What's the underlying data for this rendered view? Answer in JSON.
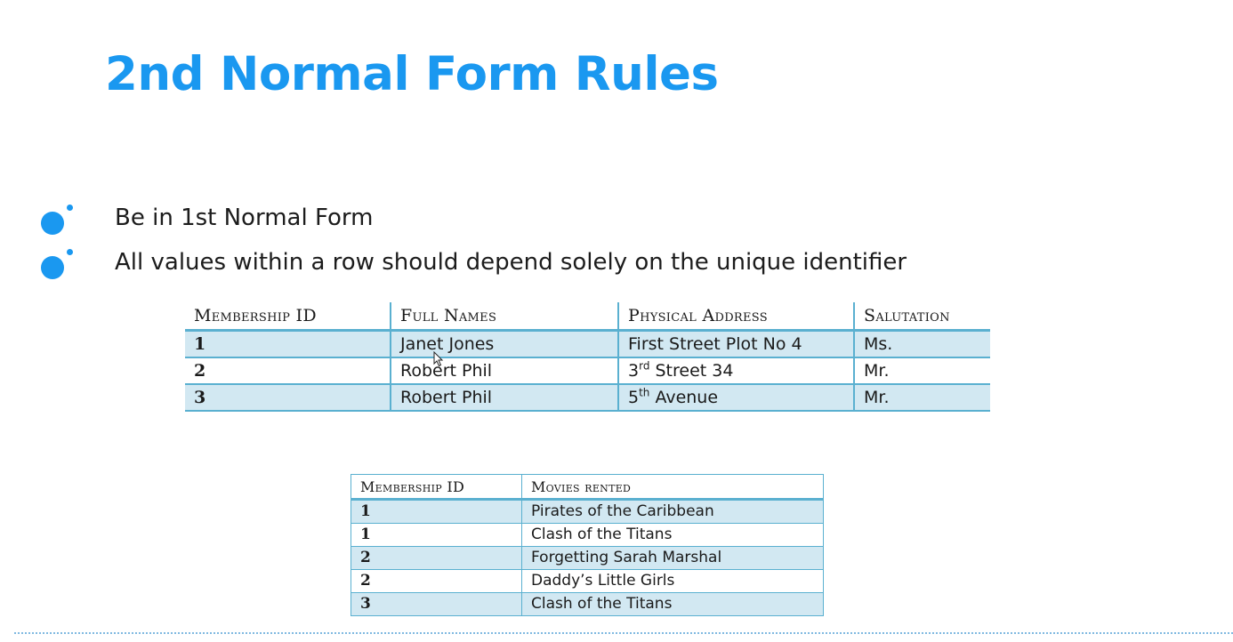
{
  "slide": {
    "title": "2nd Normal Form Rules",
    "accent_color": "#1a98f0",
    "bullets": [
      {
        "icon": "bullet-dot-icon",
        "text": "Be in 1st Normal Form"
      },
      {
        "icon": "bullet-dot-icon",
        "text": "All values within a row should depend solely on the unique identifier"
      }
    ]
  },
  "table_members": {
    "headers": [
      "Membership ID",
      "Full Names",
      "Physical Address",
      "Salutation"
    ],
    "rows": [
      {
        "id": "1",
        "name": "Janet Jones",
        "address_main": "First Street Plot No 4",
        "address_sup": "",
        "address_rest": "",
        "salutation": "Ms."
      },
      {
        "id": "2",
        "name": "Robert Phil",
        "address_main": "3",
        "address_sup": "rd",
        "address_rest": " Street 34",
        "salutation": "Mr."
      },
      {
        "id": "3",
        "name": "Robert Phil",
        "address_main": "5",
        "address_sup": "th",
        "address_rest": " Avenue",
        "salutation": "Mr."
      }
    ]
  },
  "table_movies": {
    "headers": [
      "Membership ID",
      "Movies rented"
    ],
    "rows": [
      {
        "id": "1",
        "movie": "Pirates of the Caribbean"
      },
      {
        "id": "1",
        "movie": "Clash of the Titans"
      },
      {
        "id": "2",
        "movie": "Forgetting Sarah Marshal"
      },
      {
        "id": "2",
        "movie": "Daddy’s Little Girls"
      },
      {
        "id": "3",
        "movie": "Clash of the Titans"
      }
    ]
  },
  "colors": {
    "table_border": "#5ab0d0",
    "table_shade": "#d2e8f2",
    "footer_dots": "#7fb8e0"
  }
}
